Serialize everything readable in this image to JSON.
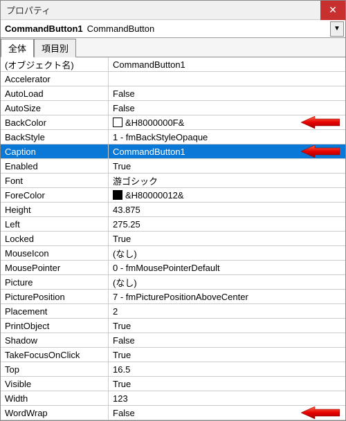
{
  "title": "プロパティ",
  "object": {
    "name": "CommandButton1",
    "type": "CommandButton"
  },
  "tabs": {
    "all": "全体",
    "categorized": "項目別"
  },
  "rows": [
    {
      "name": "(オブジェクト名)",
      "value": "CommandButton1"
    },
    {
      "name": "Accelerator",
      "value": ""
    },
    {
      "name": "AutoLoad",
      "value": "False"
    },
    {
      "name": "AutoSize",
      "value": "False"
    },
    {
      "name": "BackColor",
      "value": "&H8000000F&",
      "swatch": "white",
      "arrow": true
    },
    {
      "name": "BackStyle",
      "value": "1 - fmBackStyleOpaque"
    },
    {
      "name": "Caption",
      "value": "CommandButton1",
      "selected": true,
      "arrow": true
    },
    {
      "name": "Enabled",
      "value": "True"
    },
    {
      "name": "Font",
      "value": "游ゴシック"
    },
    {
      "name": "ForeColor",
      "value": "&H80000012&",
      "swatch": "black"
    },
    {
      "name": "Height",
      "value": "43.875"
    },
    {
      "name": "Left",
      "value": "275.25"
    },
    {
      "name": "Locked",
      "value": "True"
    },
    {
      "name": "MouseIcon",
      "value": "(なし)"
    },
    {
      "name": "MousePointer",
      "value": "0 - fmMousePointerDefault"
    },
    {
      "name": "Picture",
      "value": "(なし)"
    },
    {
      "name": "PicturePosition",
      "value": "7 - fmPicturePositionAboveCenter"
    },
    {
      "name": "Placement",
      "value": "2"
    },
    {
      "name": "PrintObject",
      "value": "True"
    },
    {
      "name": "Shadow",
      "value": "False"
    },
    {
      "name": "TakeFocusOnClick",
      "value": "True"
    },
    {
      "name": "Top",
      "value": "16.5"
    },
    {
      "name": "Visible",
      "value": "True"
    },
    {
      "name": "Width",
      "value": "123"
    },
    {
      "name": "WordWrap",
      "value": "False",
      "arrow": true
    }
  ]
}
